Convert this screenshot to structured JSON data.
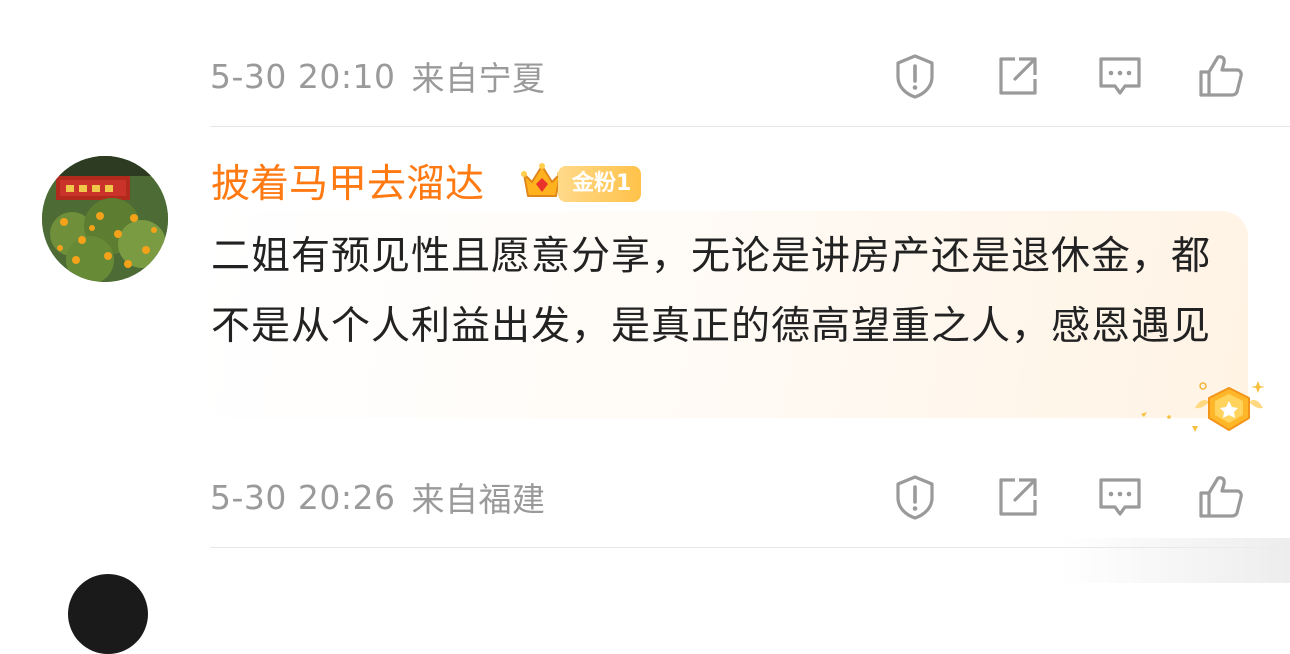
{
  "comments": [
    {
      "date": "5-30 20:10",
      "location": "来自宁夏"
    },
    {
      "username": "披着马甲去溜达",
      "badge": "金粉1",
      "text": "二姐有预见性且愿意分享，无论是讲房产还是退休金，都不是从个人利益出发，是真正的德高望重之人，感恩遇见",
      "date": "5-30 20:26",
      "location": "来自福建"
    }
  ],
  "icons": [
    "report-icon",
    "share-icon",
    "comment-icon",
    "like-icon"
  ],
  "colors": {
    "username": "#ff7a12",
    "meta_text": "#9a9a9a",
    "body_text": "#222222",
    "divider": "#e6e6e6",
    "badge": "#ffc24a"
  }
}
